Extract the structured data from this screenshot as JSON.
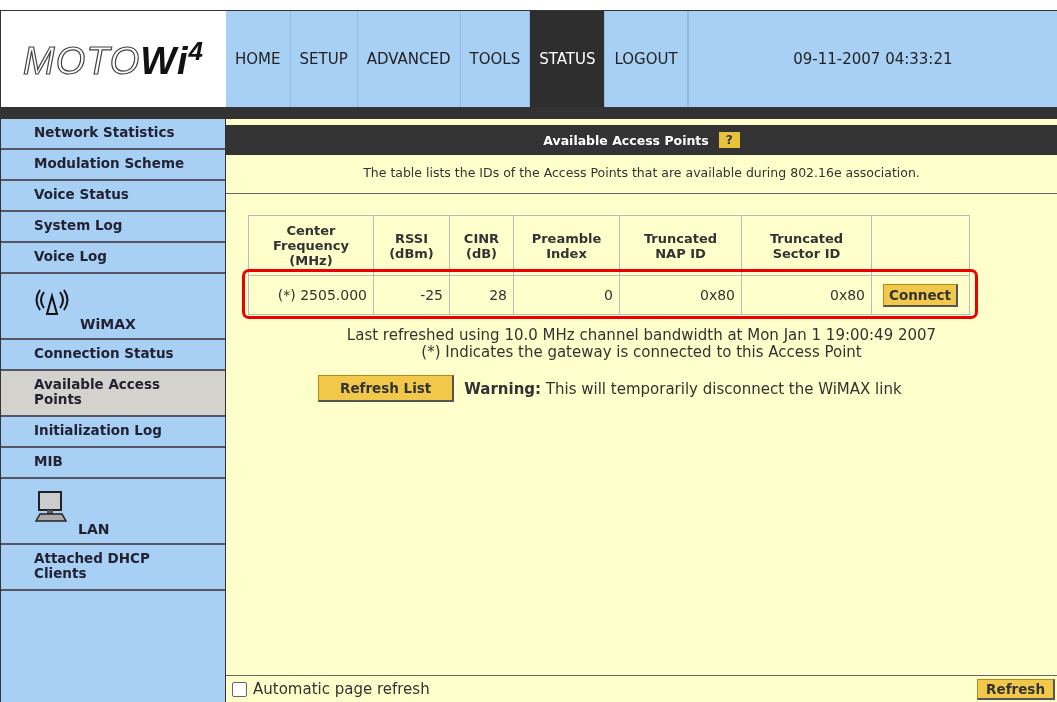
{
  "logo": {
    "text": "MOTO**Wi**$^{4}$"
  },
  "nav": [
    {
      "label": "HOME",
      "selected": false
    },
    {
      "label": "SETUP",
      "selected": false
    },
    {
      "label": "ADVANCED",
      "selected": false
    },
    {
      "label": "TOOLS",
      "selected": false
    },
    {
      "label": "STATUS",
      "selected": true
    },
    {
      "label": "LOGOUT",
      "selected": false
    }
  ],
  "datetime": "09-11-2007 04:33:21",
  "sidebar": {
    "items": [
      {
        "kind": "link",
        "label": "Network Statistics",
        "selected": false
      },
      {
        "kind": "link",
        "label": "Modulation Scheme",
        "selected": false
      },
      {
        "kind": "link",
        "label": "Voice Status",
        "selected": false
      },
      {
        "kind": "link",
        "label": "System Log",
        "selected": false
      },
      {
        "kind": "link",
        "label": "Voice Log",
        "selected": false
      },
      {
        "kind": "wireless",
        "label": "WiMAX"
      },
      {
        "kind": "link",
        "label": "Connection Status",
        "selected": false
      },
      {
        "kind": "link",
        "label": "Available Access Points",
        "selected": true
      },
      {
        "kind": "link",
        "label": "Initialization Log",
        "selected": false
      },
      {
        "kind": "link",
        "label": "MIB",
        "selected": false
      },
      {
        "kind": "wired",
        "label": "LAN"
      },
      {
        "kind": "link",
        "label": "Attached DHCP Clients",
        "selected": false
      }
    ]
  },
  "panel": {
    "title": "Available Access Points",
    "help": "?",
    "description": "The table lists the IDs of the Access Points that are available during 802.16e association.",
    "table": {
      "columns": [
        "Center Frequency (MHz)",
        "RSSI (dBm)",
        "CINR (dB)",
        "Preamble Index",
        "Truncated NAP ID",
        "Truncated Sector ID"
      ],
      "rows": [
        {
          "cells": [
            "(*) 2505.000",
            "-25",
            "28",
            "0",
            "0x80",
            "0x80"
          ],
          "action": "Connect",
          "highlighted": true
        }
      ]
    },
    "notes": [
      "Last refreshed using 10.0 MHz channel bandwidth at Mon Jan 1 19:00:49 2007",
      "(*) Indicates the gateway is connected to this Access Point"
    ],
    "refresh_button": "Refresh List",
    "warning": "**Warning:** This will temporarily disconnect the WiMAX link"
  },
  "footer": {
    "auto_refresh": {
      "label": "Automatic page refresh",
      "checked": false
    },
    "refresh_button": "Refresh"
  }
}
